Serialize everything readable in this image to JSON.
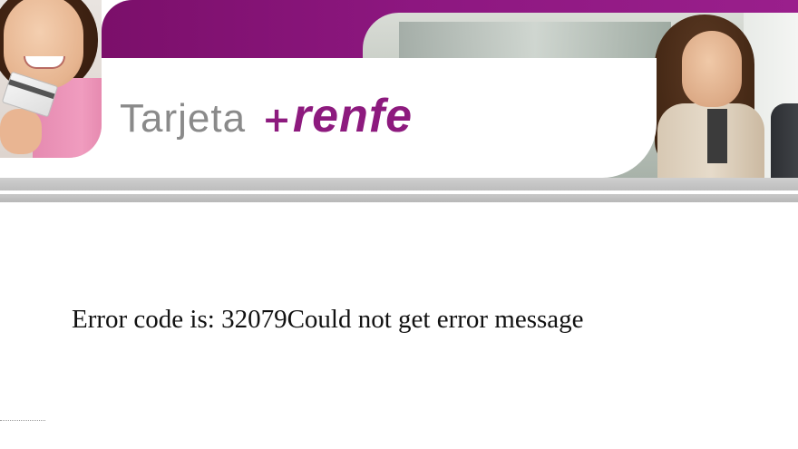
{
  "header": {
    "logo": {
      "prefix": "Tarjeta",
      "plus": "+",
      "brand": "renfe"
    },
    "colors": {
      "brand_purple": "#8d1a7e",
      "logo_grey": "#8a8a8a",
      "separator_grey": "#c4c4c4"
    }
  },
  "main": {
    "error_text": "Error code is: 32079Could not get error message"
  }
}
